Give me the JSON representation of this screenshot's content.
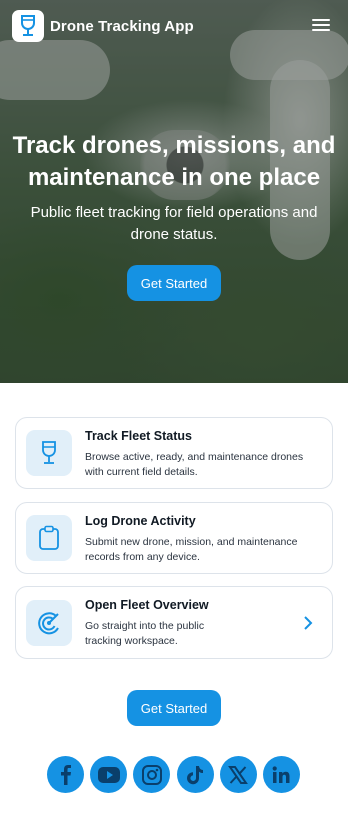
{
  "header": {
    "app_name": "Drone Tracking App",
    "logo_icon": "drone-glass-icon",
    "menu_icon": "hamburger-icon"
  },
  "hero": {
    "title": "Track drones, missions, and maintenance in one place",
    "subtitle": "Public fleet tracking for field operations and drone status.",
    "cta_label": "Get Started"
  },
  "features": [
    {
      "title": "Track Fleet Status",
      "text": "Browse active, ready, and maintenance drones with current field details.",
      "icon": "drone-glass-icon"
    },
    {
      "title": "Log Drone Activity",
      "text": "Submit new drone, mission, and maintenance records from any device.",
      "icon": "clipboard-icon"
    },
    {
      "title": "Open Fleet Overview",
      "text": "Go straight into the public tracking workspace.",
      "icon": "radar-icon",
      "action_icon": "chevron-right-icon"
    }
  ],
  "footer": {
    "cta_label": "Get Started",
    "social": [
      "facebook-icon",
      "youtube-icon",
      "instagram-icon",
      "tiktok-icon",
      "x-icon",
      "linkedin-icon"
    ]
  },
  "colors": {
    "accent": "#1592e3",
    "icon_bg": "#e1eff9",
    "card_border": "#dde3ea"
  }
}
